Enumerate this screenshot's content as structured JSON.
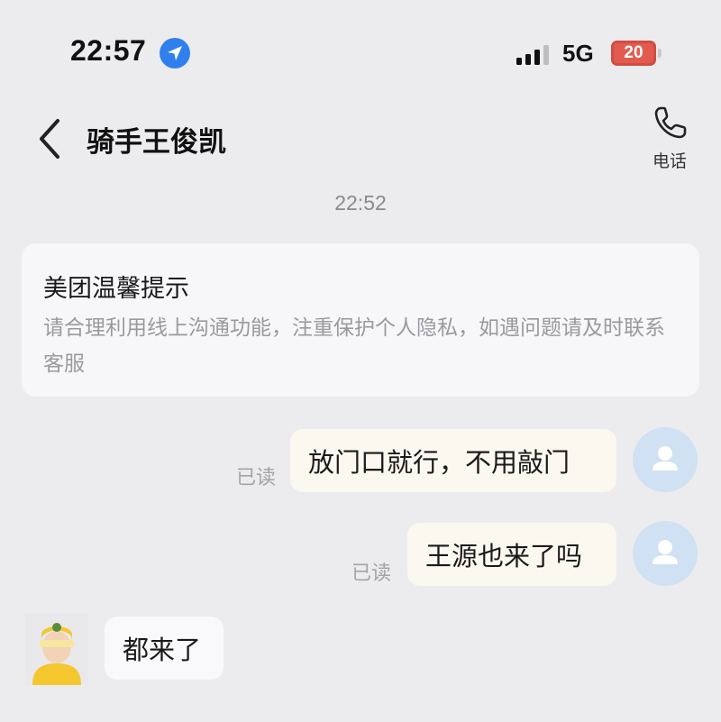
{
  "status_bar": {
    "time": "22:57",
    "network": "5G",
    "battery": "20"
  },
  "header": {
    "title": "骑手王俊凯",
    "call_label": "电话"
  },
  "chat": {
    "timestamp": "22:52",
    "tips": {
      "title": "美团温馨提示",
      "body": "请合理利用线上沟通功能，注重保护个人隐私，如遇问题请及时联系客服"
    },
    "messages": [
      {
        "sender": "me",
        "text": "放门口就行，不用敲门",
        "status": "已读"
      },
      {
        "sender": "me",
        "text": "王源也来了吗",
        "status": "已读"
      },
      {
        "sender": "rider",
        "text": "都来了"
      }
    ]
  },
  "colors": {
    "background": "#ececef",
    "location_blue": "#2f80ed",
    "battery_red": "#e25b4f",
    "my_avatar": "#cfe1f3"
  },
  "icons": [
    "location-arrow-icon",
    "signal-bars-icon",
    "battery-icon",
    "back-chevron-icon",
    "phone-icon",
    "user-avatar-icon"
  ]
}
